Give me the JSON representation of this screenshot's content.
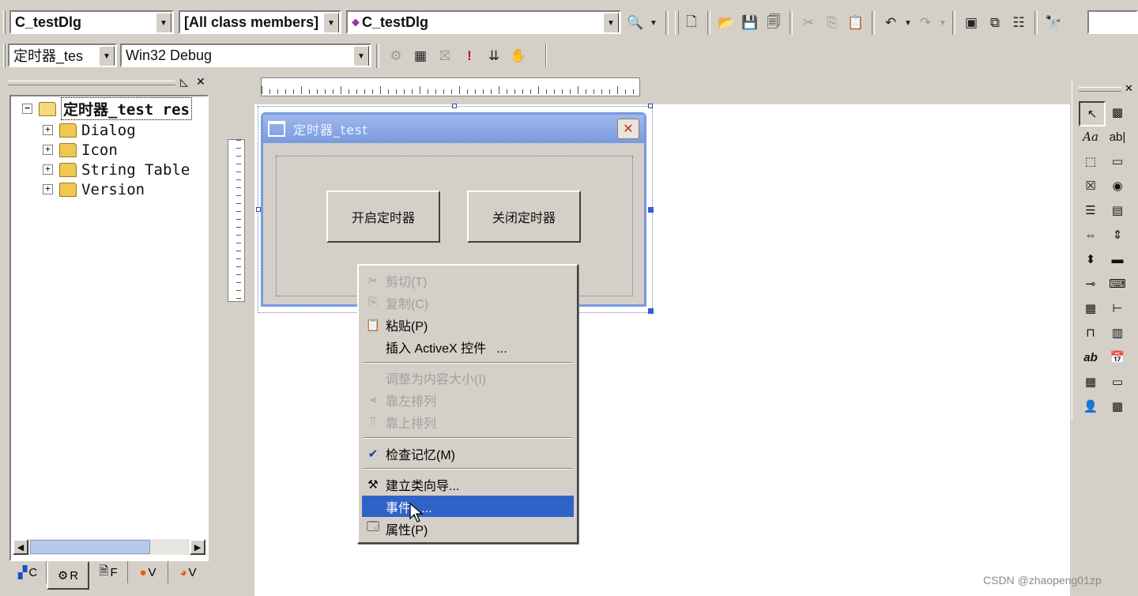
{
  "toolbar1": {
    "class_combo": "C_testDlg",
    "filter_combo": "[All class members]",
    "member_combo": "C_testDlg"
  },
  "toolbar2": {
    "project_combo": "定时器_tes",
    "config_combo": "Win32 Debug"
  },
  "workspace": {
    "tree_root": "定时器_test res",
    "tree_items": [
      "Dialog",
      "Icon",
      "String Table",
      "Version"
    ],
    "tabs": [
      "C",
      "R",
      "F",
      "V",
      "V"
    ]
  },
  "dialog": {
    "title": "定时器_test",
    "close_glyph": "✕",
    "start_button": "开启定时器",
    "stop_button": "关闭定时器"
  },
  "context_menu": {
    "items": [
      {
        "label": "剪切(T)",
        "icon": "scissors-icon",
        "enabled": false
      },
      {
        "label": "复制(C)",
        "icon": "copy-icon",
        "enabled": false
      },
      {
        "label": "粘贴(P)",
        "icon": "paste-icon",
        "enabled": true
      },
      {
        "label": "插入 ActiveX 控件   ...",
        "icon": "",
        "enabled": true
      },
      {
        "label": "调整为内容大小(I)",
        "icon": "",
        "enabled": false
      },
      {
        "label": "靠左排列",
        "icon": "align-left-icon",
        "enabled": false
      },
      {
        "label": "靠上排列",
        "icon": "align-top-icon",
        "enabled": false
      },
      {
        "label": "检查记忆(M)",
        "icon": "check-mnemonics-icon",
        "enabled": true
      },
      {
        "label": "建立类向导...",
        "icon": "class-wizard-icon",
        "enabled": true
      },
      {
        "label": "事件   ...",
        "icon": "",
        "enabled": true,
        "highlighted": true
      },
      {
        "label": "属性(P)",
        "icon": "properties-icon",
        "enabled": true
      }
    ]
  },
  "watermark": "CSDN @zhaopeng01zp",
  "colors": {
    "face": "#d4d0c8",
    "title_bar": "#7a9ae0",
    "highlight": "#2f63c7"
  }
}
